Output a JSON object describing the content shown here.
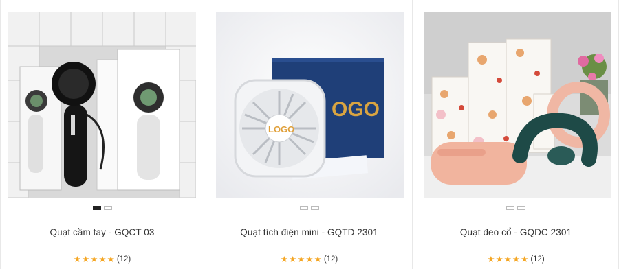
{
  "products": [
    {
      "name": "Quạt cầm tay - GQCT 03",
      "rating_count": "(12)",
      "stars": 5,
      "slides": 2,
      "active_slide": 0
    },
    {
      "name": "Quạt tích điện mini - GQTD 2301",
      "rating_count": "(12)",
      "stars": 5,
      "slides": 2,
      "active_slide": -1
    },
    {
      "name": "Quạt đeo cổ - GQDC 2301",
      "rating_count": "(12)",
      "stars": 5,
      "slides": 2,
      "active_slide": -1
    }
  ],
  "photo_text": {
    "logo": "LOGO",
    "box_logo": "OGO"
  },
  "colors": {
    "star": "#f5a623",
    "active_dot": "#222222",
    "border": "#e8e8e8"
  }
}
